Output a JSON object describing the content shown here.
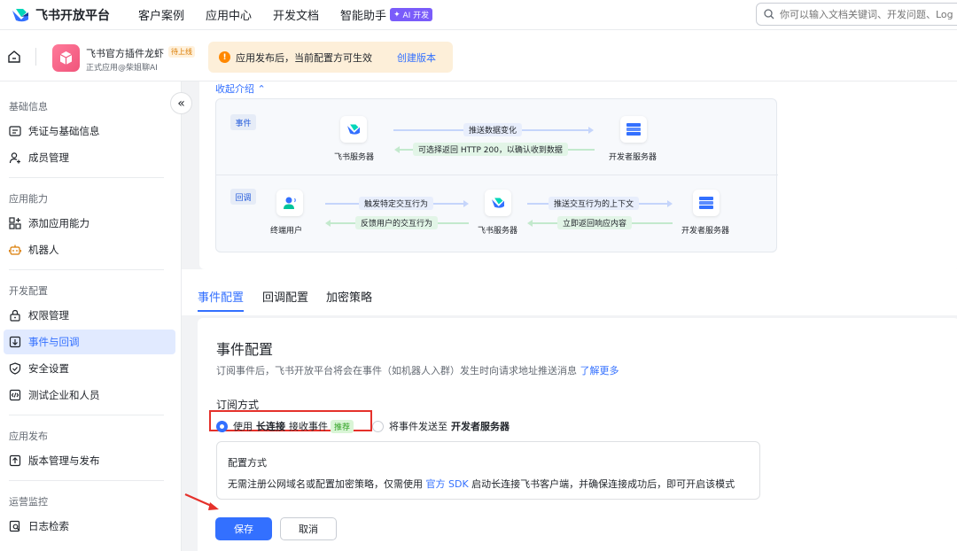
{
  "topnav": {
    "logo_text": "飞书开放平台",
    "items": [
      "客户案例",
      "应用中心",
      "开发文档",
      "智能助手"
    ],
    "ai_badge": "AI 开发",
    "search_placeholder": "你可以输入文档关键词、开发问题、Log"
  },
  "app": {
    "name": "飞书官方插件龙虾",
    "status": "待上线",
    "owner": "正式应用@柴姐聊AI",
    "notice": "应用发布后，当前配置方可生效",
    "notice_link": "创建版本"
  },
  "sidebar": {
    "groups": [
      {
        "title": "基础信息",
        "items": [
          "凭证与基础信息",
          "成员管理"
        ]
      },
      {
        "title": "应用能力",
        "items": [
          "添加应用能力",
          "机器人"
        ]
      },
      {
        "title": "开发配置",
        "items": [
          "权限管理",
          "事件与回调",
          "安全设置",
          "测试企业和人员"
        ]
      },
      {
        "title": "应用发布",
        "items": [
          "版本管理与发布"
        ]
      },
      {
        "title": "运营监控",
        "items": [
          "日志检索"
        ]
      }
    ],
    "active_item": "事件与回调"
  },
  "intro": {
    "toggle": "收起介绍",
    "event": {
      "tag": "事件",
      "node_left": "飞书服务器",
      "node_right": "开发者服务器",
      "arrow_right": "推送数据变化",
      "arrow_left": "可选择返回 HTTP 200，以确认收到数据"
    },
    "callback": {
      "tag": "回调",
      "node_user": "终端用户",
      "node_mid": "飞书服务器",
      "node_right": "开发者服务器",
      "arrow1_right": "触发特定交互行为",
      "arrow1_left": "反馈用户的交互行为",
      "arrow2_right": "推送交互行为的上下文",
      "arrow2_left": "立即返回响应内容"
    }
  },
  "tabs": [
    "事件配置",
    "回调配置",
    "加密策略"
  ],
  "config": {
    "title": "事件配置",
    "desc": "订阅事件后，飞书开放平台将会在事件（如机器人入群）发生时向请求地址推送消息",
    "desc_link": "了解更多",
    "subscribe_title": "订阅方式",
    "option1_pre": "使用",
    "option1_bold": "长连接",
    "option1_post": "接收事件",
    "option1_badge": "推荐",
    "option2_pre": "将事件发送至",
    "option2_bold": "开发者服务器",
    "mode_title": "配置方式",
    "mode_desc_pre": "无需注册公网域名或配置加密策略，仅需使用",
    "mode_desc_link": "官方 SDK",
    "mode_desc_post": "启动长连接飞书客户端，并确保连接成功后，即可开启该模式",
    "save": "保存",
    "cancel": "取消"
  },
  "colors": {
    "primary": "#3370ff",
    "highlight": "#e5312b",
    "notice_bg": "#fdefd9"
  }
}
